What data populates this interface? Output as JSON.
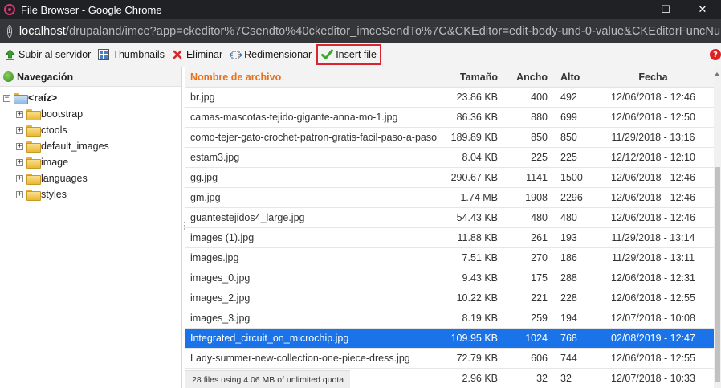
{
  "window": {
    "title": "File Browser - Google Chrome",
    "minimize": "—",
    "maximize": "☐",
    "close": "✕"
  },
  "address": {
    "host": "localhost",
    "path": "/drupaland/imce?app=ckeditor%7Csendto%40ckeditor_imceSendTo%7C&CKEditor=edit-body-und-0-value&CKEditorFuncNum..."
  },
  "toolbar": {
    "upload_label": "Subir al servidor",
    "thumbnails_label": "Thumbnails",
    "delete_label": "Eliminar",
    "resize_label": "Redimensionar",
    "insert_label": "Insert file",
    "help": "?"
  },
  "nav": {
    "header": "Navegación",
    "root": "<raíz>",
    "folders": [
      "bootstrap",
      "ctools",
      "default_images",
      "image",
      "languages",
      "styles"
    ]
  },
  "files": {
    "columns": {
      "name": "Nombre de archivo",
      "size": "Tamaño",
      "width": "Ancho",
      "height": "Alto",
      "date": "Fecha"
    },
    "rows": [
      {
        "name": "br.jpg",
        "size": "23.86 KB",
        "width": "400",
        "height": "492",
        "date": "12/06/2018 - 12:46"
      },
      {
        "name": "camas-mascotas-tejido-gigante-anna-mo-1.jpg",
        "size": "86.36 KB",
        "width": "880",
        "height": "699",
        "date": "12/06/2018 - 12:50"
      },
      {
        "name": "como-tejer-gato-crochet-patron-gratis-facil-paso-a-paso",
        "size": "189.89 KB",
        "width": "850",
        "height": "850",
        "date": "11/29/2018 - 13:16"
      },
      {
        "name": "estam3.jpg",
        "size": "8.04 KB",
        "width": "225",
        "height": "225",
        "date": "12/12/2018 - 12:10"
      },
      {
        "name": "gg.jpg",
        "size": "290.67 KB",
        "width": "1141",
        "height": "1500",
        "date": "12/06/2018 - 12:46"
      },
      {
        "name": "gm.jpg",
        "size": "1.74 MB",
        "width": "1908",
        "height": "2296",
        "date": "12/06/2018 - 12:46"
      },
      {
        "name": "guantestejidos4_large.jpg",
        "size": "54.43 KB",
        "width": "480",
        "height": "480",
        "date": "12/06/2018 - 12:46"
      },
      {
        "name": "images (1).jpg",
        "size": "11.88 KB",
        "width": "261",
        "height": "193",
        "date": "11/29/2018 - 13:14"
      },
      {
        "name": "images.jpg",
        "size": "7.51 KB",
        "width": "270",
        "height": "186",
        "date": "11/29/2018 - 13:11"
      },
      {
        "name": "images_0.jpg",
        "size": "9.43 KB",
        "width": "175",
        "height": "288",
        "date": "12/06/2018 - 12:31"
      },
      {
        "name": "images_2.jpg",
        "size": "10.22 KB",
        "width": "221",
        "height": "228",
        "date": "12/06/2018 - 12:55"
      },
      {
        "name": "images_3.jpg",
        "size": "8.19 KB",
        "width": "259",
        "height": "194",
        "date": "12/07/2018 - 10:08"
      },
      {
        "name": "Integrated_circuit_on_microchip.jpg",
        "size": "109.95 KB",
        "width": "1024",
        "height": "768",
        "date": "02/08/2019 - 12:47",
        "selected": true
      },
      {
        "name": "Lady-summer-new-collection-one-piece-dress.jpg",
        "size": "72.79 KB",
        "width": "606",
        "height": "744",
        "date": "12/06/2018 - 12:55"
      },
      {
        "name": "",
        "size": "2.96 KB",
        "width": "32",
        "height": "32",
        "date": "12/07/2018 - 10:33"
      }
    ],
    "quota": "28 files using 4.06 MB of unlimited quota"
  },
  "colors": {
    "selected_row": "#1a73e8",
    "header_accent": "#e8701a",
    "highlight_border": "#d9252f"
  }
}
